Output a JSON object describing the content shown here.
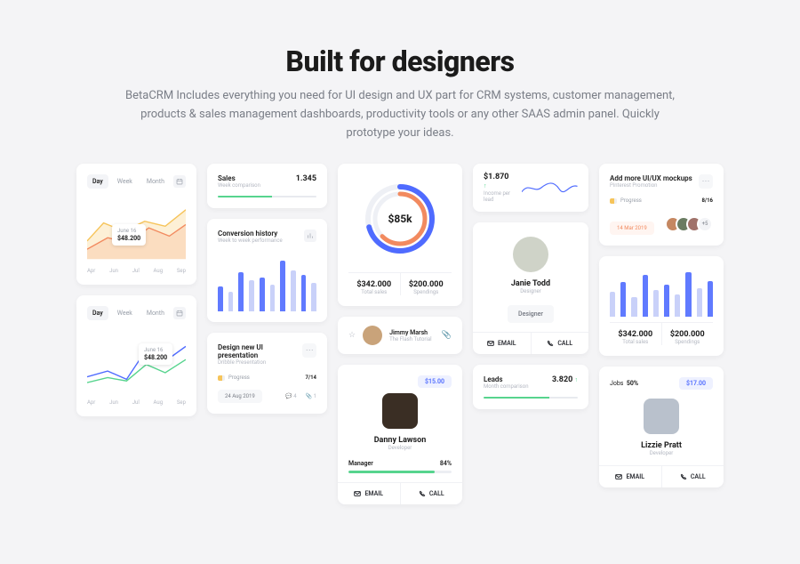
{
  "hero": {
    "title": "Built for designers",
    "subtitle": "BetaCRM Includes everything you need for UI design and UX part for CRM systems, customer management, products & sales management dashboards, productivity tools or any other SAAS admin panel. Quickly prototype your ideas."
  },
  "tabs": {
    "day": "Day",
    "week": "Week",
    "month": "Month"
  },
  "chart1": {
    "months": [
      "Apr",
      "Jun",
      "Jul",
      "Aug",
      "Sep"
    ],
    "callout": {
      "date": "June 16",
      "value": "$48.200"
    }
  },
  "chart2": {
    "months": [
      "Apr",
      "Jun",
      "Jul",
      "Aug",
      "Sep"
    ],
    "callout": {
      "date": "June 16",
      "value": "$48.200"
    }
  },
  "sales": {
    "title": "Sales",
    "subtitle": "Week comparison",
    "value": "1.345"
  },
  "conv": {
    "title": "Conversion history",
    "subtitle": "Week to week performance"
  },
  "task": {
    "title": "Design new UI presentation",
    "subtitle": "Dribble Presentation",
    "progress_label": "Progress",
    "progress_value": "7/14",
    "date": "24 Aug 2019",
    "comments": "4",
    "attachments": "1"
  },
  "ring": {
    "value": "$85k",
    "stat1_value": "$342.000",
    "stat1_label": "Total sales",
    "stat2_value": "$200.000",
    "stat2_label": "Spendings"
  },
  "tutorial": {
    "name": "Jimmy Marsh",
    "sub": "The Flash Tutorial"
  },
  "danny": {
    "price": "$15.00",
    "name": "Danny Lawson",
    "role": "Developer",
    "metric_label": "Manager",
    "metric_value": "84%",
    "email": "EMAIL",
    "call": "CALL"
  },
  "income": {
    "value": "$1.870",
    "label": "Income per lead"
  },
  "janie": {
    "name": "Janie Todd",
    "role": "Designer",
    "chip": "Designer",
    "email": "EMAIL",
    "call": "CALL"
  },
  "leads": {
    "title": "Leads",
    "subtitle": "Month comparison",
    "value": "3.820"
  },
  "mockups": {
    "title": "Add more UI/UX mockups",
    "subtitle": "Pinterest Promotion",
    "progress_label": "Progress",
    "progress_value": "8/16",
    "date": "14 Mar 2019",
    "plus": "+5"
  },
  "bars2": {
    "stat1_value": "$342.000",
    "stat1_label": "Total sales",
    "stat2_value": "$200.000",
    "stat2_label": "Spendings"
  },
  "lizzie": {
    "jobs_label": "Jobs",
    "jobs_value": "50%",
    "price": "$17.00",
    "name": "Lizzie Pratt",
    "role": "Developer",
    "email": "EMAIL",
    "call": "CALL"
  }
}
